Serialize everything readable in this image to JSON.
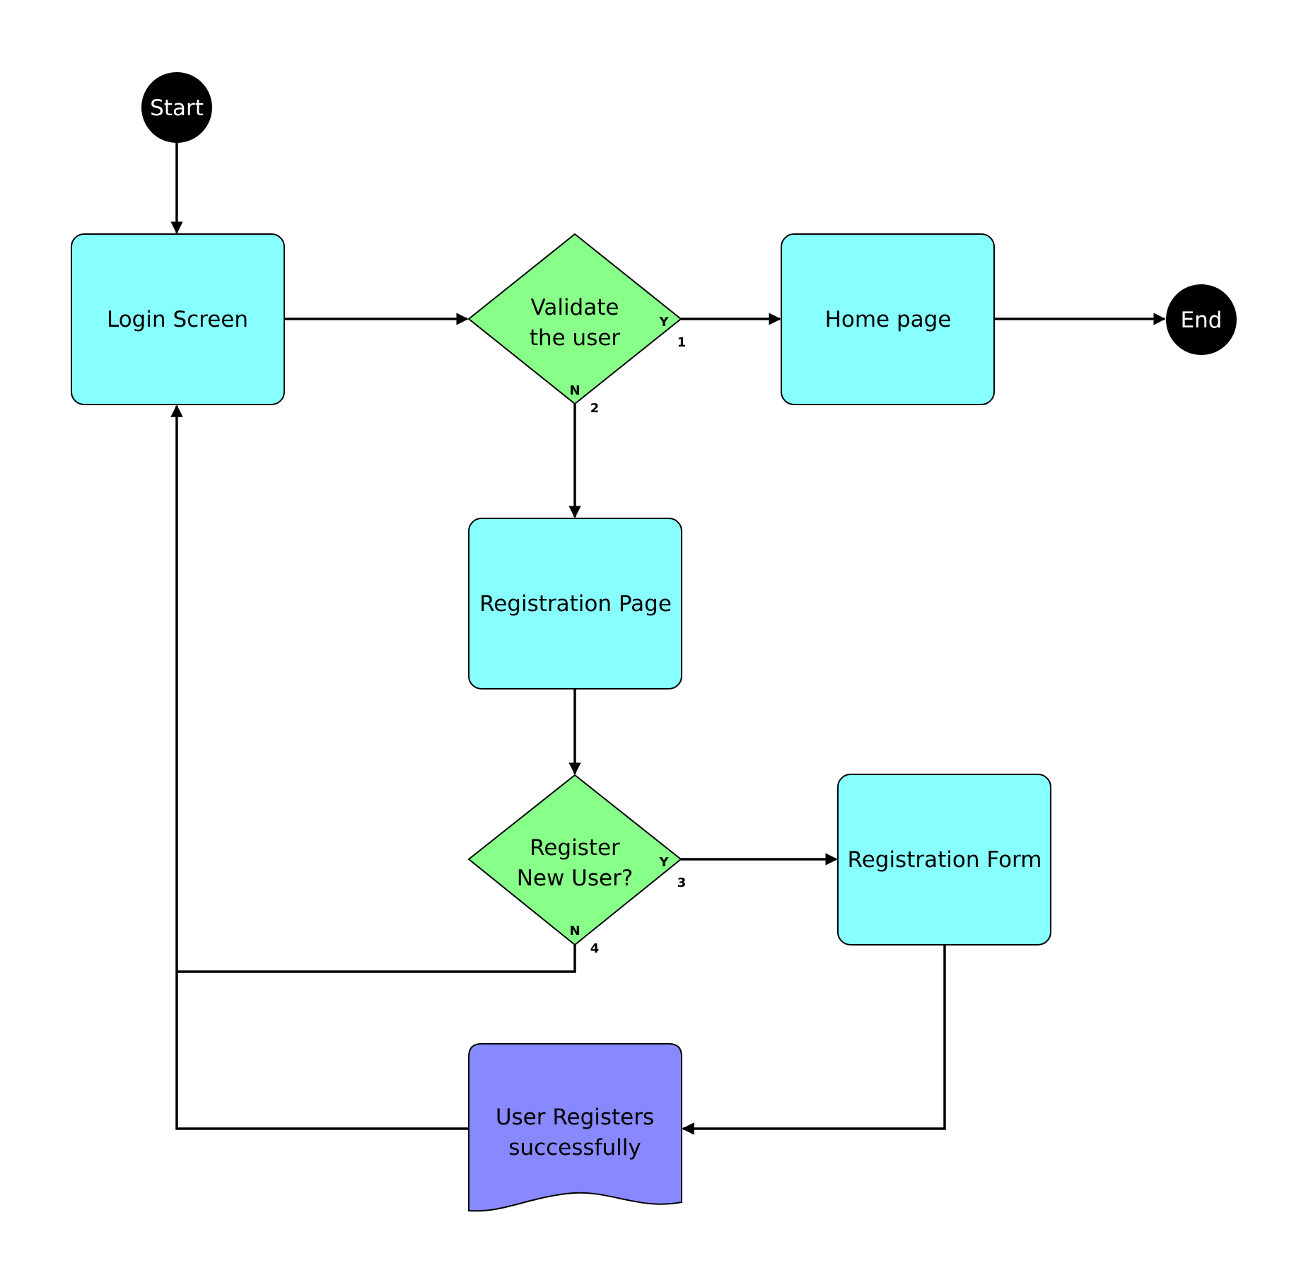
{
  "diagram": {
    "type": "flowchart",
    "colors": {
      "process": "#88ffff",
      "decision": "#88ff88",
      "document": "#8888ff",
      "terminal": "#000000",
      "line": "#000000"
    },
    "nodes": {
      "start": {
        "label": "Start",
        "kind": "terminal"
      },
      "login": {
        "label": "Login Screen",
        "kind": "process"
      },
      "validate": {
        "label_line1": "Validate",
        "label_line2": "the user",
        "kind": "decision",
        "yes": "Y",
        "no": "N",
        "yes_port": "1",
        "no_port": "2"
      },
      "home": {
        "label": "Home page",
        "kind": "process"
      },
      "end": {
        "label": "End",
        "kind": "terminal"
      },
      "regpage": {
        "label": "Registration Page",
        "kind": "process"
      },
      "register": {
        "label_line1": "Register",
        "label_line2": "New User?",
        "kind": "decision",
        "yes": "Y",
        "no": "N",
        "yes_port": "3",
        "no_port": "4"
      },
      "regform": {
        "label": "Registration Form",
        "kind": "process"
      },
      "success": {
        "label_line1": "User Registers",
        "label_line2": "successfully",
        "kind": "document"
      }
    },
    "edges": [
      {
        "from": "Start",
        "to": "Login Screen"
      },
      {
        "from": "Login Screen",
        "to": "Validate the user"
      },
      {
        "from": "Validate the user",
        "to": "Home page",
        "branch": "Y"
      },
      {
        "from": "Home page",
        "to": "End"
      },
      {
        "from": "Validate the user",
        "to": "Registration Page",
        "branch": "N"
      },
      {
        "from": "Registration Page",
        "to": "Register New User?"
      },
      {
        "from": "Register New User?",
        "to": "Registration Form",
        "branch": "Y"
      },
      {
        "from": "Register New User?",
        "to": "Login Screen",
        "branch": "N"
      },
      {
        "from": "Registration Form",
        "to": "User Registers successfully"
      },
      {
        "from": "User Registers successfully",
        "to": "Login Screen"
      }
    ]
  }
}
